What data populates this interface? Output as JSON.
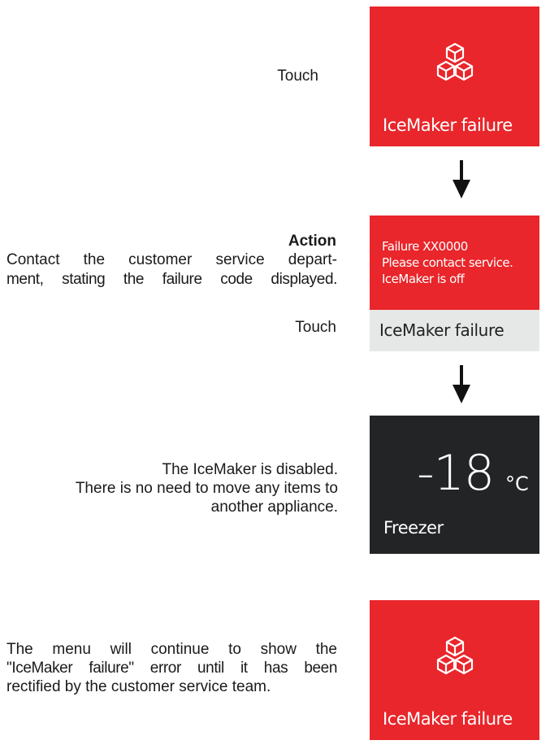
{
  "step1": {
    "instruction": "Touch",
    "panel": {
      "icon": "ice-cubes-icon",
      "label": "IceMaker failure",
      "color": "#e8262b"
    }
  },
  "step2": {
    "action_title": "Action",
    "action_line1": "Contact the customer service depart-",
    "action_line2": "ment, stating the failure code displayed.",
    "instruction": "Touch",
    "panel": {
      "line1": "Failure XX0000",
      "line2": "Please contact service.",
      "line3": "IceMaker is off",
      "footer": "IceMaker failure",
      "color": "#e8262b",
      "footer_color": "#e6e8e7"
    }
  },
  "step3": {
    "text_line1": "The IceMaker is disabled.",
    "text_line2": "There is no need to move any items to",
    "text_line3": "another appliance.",
    "panel": {
      "temperature": "-18",
      "unit": "°C",
      "label": "Freezer",
      "color": "#222425"
    }
  },
  "step4": {
    "text_line1": "The menu will continue to show the",
    "text_line2": "\"IceMaker failure\" error until it has been",
    "text_line3": "rectified by the customer service team.",
    "panel": {
      "icon": "ice-cubes-icon",
      "label": "IceMaker failure",
      "color": "#e8262b"
    }
  }
}
